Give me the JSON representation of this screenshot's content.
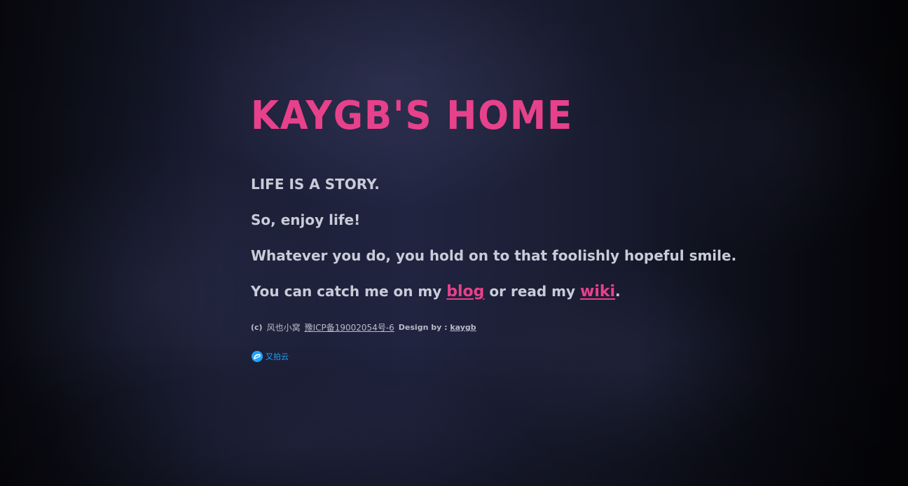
{
  "header": {
    "title": "KAYGB'S HOME"
  },
  "lines": {
    "line1": "LIFE IS A STORY.",
    "line2": "So, enjoy life!",
    "line3": "Whatever you do, you hold on to that foolishly hopeful smile.",
    "line4_prefix": "You can catch me on my ",
    "blog_link": "blog",
    "line4_middle": " or read my ",
    "wiki_link": "wiki",
    "line4_suffix": "."
  },
  "footer": {
    "copyright_mark": "(c)",
    "site_name": "风也小窝",
    "icp": "豫ICP备19002054号-6",
    "design_label": "Design by :",
    "design_author": "kaygb"
  },
  "sponsor": {
    "label": "又拍云",
    "icon": "upyun-logo-icon"
  },
  "colors": {
    "accent": "#e8418b",
    "text": "#c8ccd8",
    "sponsor": "#1fa3ff"
  }
}
